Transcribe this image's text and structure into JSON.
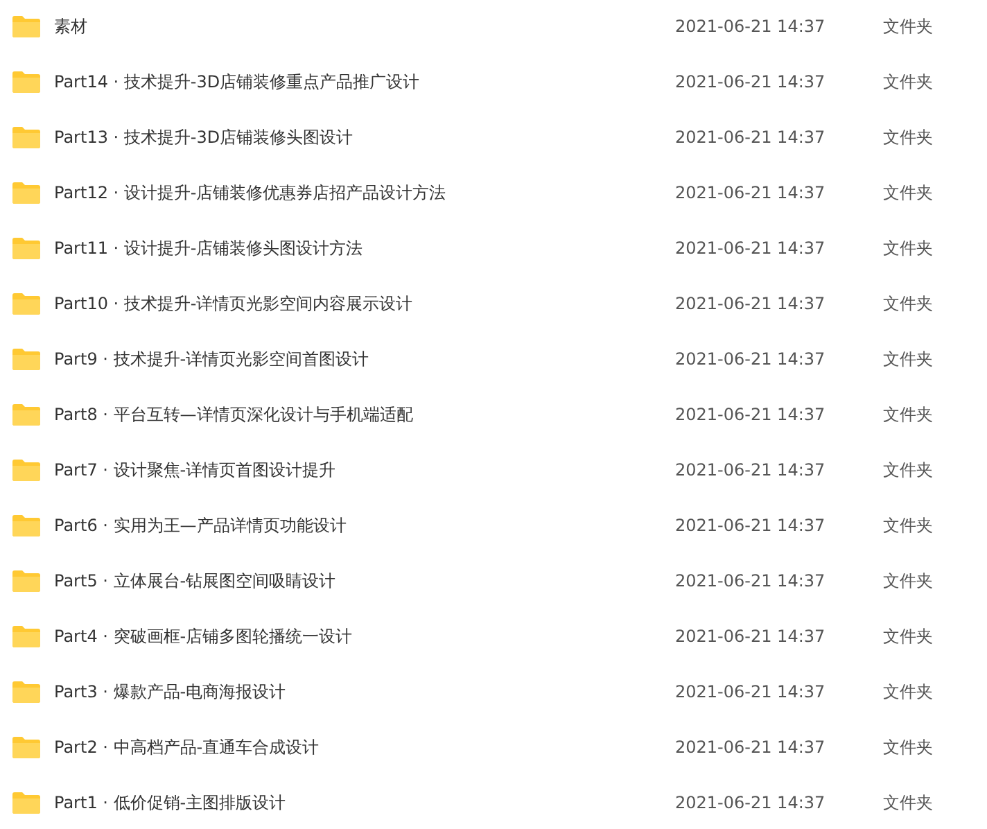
{
  "files": [
    {
      "name": "素材",
      "modified": "2021-06-21 14:37",
      "type": "文件夹"
    },
    {
      "name": "Part14 · 技术提升-3D店铺装修重点产品推广设计",
      "modified": "2021-06-21 14:37",
      "type": "文件夹"
    },
    {
      "name": "Part13 · 技术提升-3D店铺装修头图设计",
      "modified": "2021-06-21 14:37",
      "type": "文件夹"
    },
    {
      "name": "Part12 · 设计提升-店铺装修优惠券店招产品设计方法",
      "modified": "2021-06-21 14:37",
      "type": "文件夹"
    },
    {
      "name": "Part11 · 设计提升-店铺装修头图设计方法",
      "modified": "2021-06-21 14:37",
      "type": "文件夹"
    },
    {
      "name": "Part10 · 技术提升-详情页光影空间内容展示设计",
      "modified": "2021-06-21 14:37",
      "type": "文件夹"
    },
    {
      "name": "Part9 · 技术提升-详情页光影空间首图设计",
      "modified": "2021-06-21 14:37",
      "type": "文件夹"
    },
    {
      "name": "Part8 · 平台互转—详情页深化设计与手机端适配",
      "modified": "2021-06-21 14:37",
      "type": "文件夹"
    },
    {
      "name": "Part7 · 设计聚焦-详情页首图设计提升",
      "modified": "2021-06-21 14:37",
      "type": "文件夹"
    },
    {
      "name": "Part6 · 实用为王—产品详情页功能设计",
      "modified": "2021-06-21 14:37",
      "type": "文件夹"
    },
    {
      "name": "Part5 · 立体展台-钻展图空间吸睛设计",
      "modified": "2021-06-21 14:37",
      "type": "文件夹"
    },
    {
      "name": "Part4 · 突破画框-店铺多图轮播统一设计",
      "modified": "2021-06-21 14:37",
      "type": "文件夹"
    },
    {
      "name": "Part3 · 爆款产品-电商海报设计",
      "modified": "2021-06-21 14:37",
      "type": "文件夹"
    },
    {
      "name": "Part2 · 中高档产品-直通车合成设计",
      "modified": "2021-06-21 14:37",
      "type": "文件夹"
    },
    {
      "name": "Part1 · 低价促销-主图排版设计",
      "modified": "2021-06-21 14:37",
      "type": "文件夹"
    }
  ]
}
